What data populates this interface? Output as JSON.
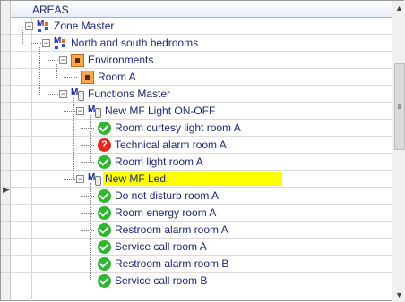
{
  "tree": {
    "header": "AREAS",
    "rows": [
      {
        "label": "Zone Master",
        "icon": "zone-master-icon",
        "level": 0,
        "expander": "−"
      },
      {
        "label": "North and south bedrooms",
        "icon": "zone-master-icon",
        "level": 1,
        "expander": "−"
      },
      {
        "label": "Environments",
        "icon": "environment-icon",
        "level": 2,
        "expander": "−"
      },
      {
        "label": "Room A",
        "icon": "environment-icon",
        "level": 3
      },
      {
        "label": "Functions Master",
        "icon": "functions-master-icon",
        "level": 2,
        "expander": "−"
      },
      {
        "label": "New MF Light ON-OFF",
        "icon": "functions-master-icon",
        "level": 3,
        "expander": "−"
      },
      {
        "label": "Room curtesy light room A",
        "icon": "check-icon",
        "level": 4
      },
      {
        "label": "Technical alarm room A",
        "icon": "alarm-icon",
        "level": 4
      },
      {
        "label": "Room light room A",
        "icon": "check-icon",
        "level": 4
      },
      {
        "label": "New MF Led",
        "icon": "functions-master-icon",
        "level": 3,
        "expander": "−",
        "selected": true
      },
      {
        "label": "Do not disturb room A",
        "icon": "check-icon",
        "level": 4
      },
      {
        "label": "Room energy room A",
        "icon": "check-icon",
        "level": 4
      },
      {
        "label": "Restroom alarm room A",
        "icon": "check-icon",
        "level": 4
      },
      {
        "label": "Service call room A",
        "icon": "check-icon",
        "level": 4
      },
      {
        "label": "Restroom alarm room B",
        "icon": "check-icon",
        "level": 4
      },
      {
        "label": "Service call room B",
        "icon": "check-icon",
        "level": 4
      }
    ]
  },
  "colors": {
    "selected_row": "#ffff00",
    "text": "#1e2a78",
    "check": "#2fb52f",
    "alarm": "#e8261f"
  },
  "scrollbar": {
    "up_icon": "scroll-up-icon",
    "down_icon": "scroll-down-icon"
  }
}
